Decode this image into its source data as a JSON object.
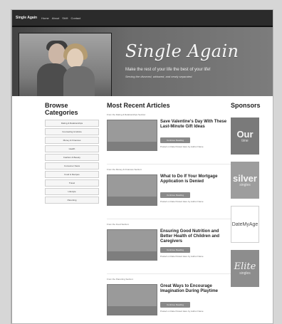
{
  "topbar": {
    "brand": "Single Again",
    "nav": [
      "Home",
      "About",
      "Sh!ft",
      "Contact"
    ]
  },
  "hero": {
    "title": "Single Again",
    "subtitle": "Make the rest of your life the best of your life!",
    "small": "Serving the divorced, widowed, and newly separated."
  },
  "left": {
    "heading": "Browse Categories",
    "categories": [
      "Dating & Relationships",
      "Counseling & Advice",
      "Money & Finances",
      "Health",
      "Fashion & Beauty",
      "Consumer News",
      "Food & Recipes",
      "Travel",
      "Lifestyle",
      "Parenting"
    ]
  },
  "middle": {
    "heading": "Most Recent Articles",
    "button_label": "Continue Reading",
    "articles": [
      {
        "section": "From the Dating & Relationships Section:",
        "title": "Save Valentine's Day With These Last-Minute Gift Ideas",
        "meta": "Posted on Date Posted Here by Author Name"
      },
      {
        "section": "From the Money & Finances Section:",
        "title": "What to Do If Your Mortgage Application is Denied",
        "meta": "Posted on Date Posted Here by Author Name"
      },
      {
        "section": "From the Food Section:",
        "title": "Ensuring Good Nutrition and Better Health of Children and Caregivers",
        "meta": "Posted on Date Posted Here by Author Name"
      },
      {
        "section": "From the Parenting Section:",
        "title": "Great Ways to Encourage Imagination During Playtime",
        "meta": "Posted on Date Posted Here by Author Name"
      }
    ]
  },
  "right": {
    "heading": "Sponsors",
    "sponsors": [
      {
        "label": "Our",
        "sub": "time",
        "color": "#7a7a7a"
      },
      {
        "label": "silver",
        "sub": "singles",
        "color": "#9d9d9d"
      },
      {
        "label": "DateMyAge",
        "sub": "",
        "color": "#ffffff"
      },
      {
        "label": "Elite",
        "sub": "singles",
        "color": "#8d8d8d"
      }
    ]
  }
}
